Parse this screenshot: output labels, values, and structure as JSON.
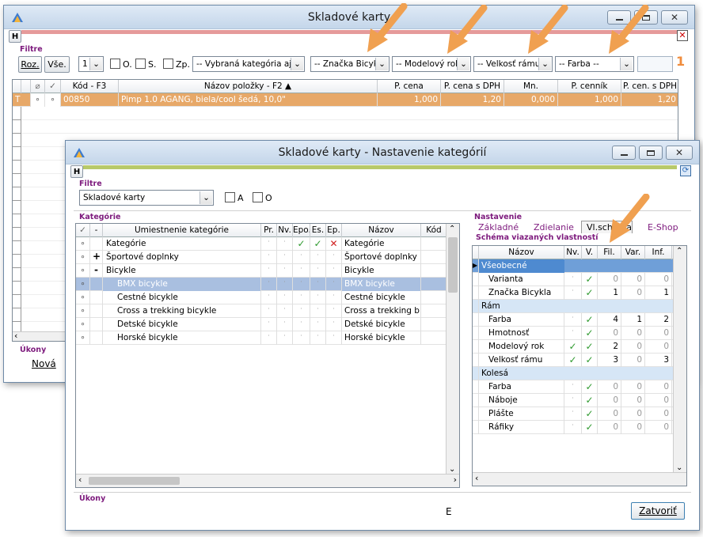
{
  "back": {
    "title": "Skladové karty",
    "h_button": "H",
    "filter_label": "Filtre",
    "btn_roz": "Roz.",
    "btn_vse": "Vše.",
    "level_value": "1",
    "chk_o": "O.",
    "chk_s": "S.",
    "chk_zp": "Zp.",
    "combo_category": "-- Vybraná kategória aj p",
    "combo_znacka": "-- Značka Bicykla",
    "combo_model": "-- Modelový rok --",
    "combo_velkost": "-- Velkosť rámu --",
    "combo_farba": "-- Farba --",
    "count_badge": "1",
    "columns": [
      "Kód - F3",
      "Názov položky - F2 ▲",
      "P. cena",
      "P. cena s DPH",
      "Mn.",
      "P. cenník",
      "P. cen. s DPH"
    ],
    "rows": [
      {
        "mark": "T",
        "code": "00850",
        "name": "Pimp 1.0 AGANG, biela/cool šedá, 10,0\"",
        "price": "1,000",
        "price_vat": "1,20",
        "qty": "0,000",
        "list": "1,000",
        "list_vat": "1,20"
      }
    ],
    "ukony_label": "Úkony",
    "nova_button": "Nová"
  },
  "front": {
    "title": "Skladové karty - Nastavenie kategórií",
    "h_button": "H",
    "filter_label": "Filtre",
    "filter_combo": "Skladové karty",
    "chk_a": "A",
    "chk_o": "O",
    "kategorie_label": "Kategórie",
    "cat_columns": [
      "✓",
      "-",
      "Umiestnenie kategórie",
      "Pr.",
      "Nv.",
      "Epo.",
      "Es.",
      "Ep.",
      "Názov",
      "Kód"
    ],
    "cat_rows": [
      {
        "dot": "∘",
        "tree": "",
        "place": "Kategórie",
        "name": "Kategórie",
        "epo": "check",
        "es": "check",
        "ep": "x"
      },
      {
        "dot": "∘",
        "tree": "+",
        "place": "Športové doplnky",
        "name": "Športové doplnky"
      },
      {
        "dot": "∘",
        "tree": "-",
        "place": "Bicykle",
        "name": "Bicykle"
      },
      {
        "dot": "∘",
        "tree": "",
        "place": "BMX bicykle",
        "name": "BMX bicykle",
        "selected": true
      },
      {
        "dot": "∘",
        "tree": "",
        "place": "Cestné bicykle",
        "name": "Cestné bicykle"
      },
      {
        "dot": "∘",
        "tree": "",
        "place": "Cross a trekking bicykle",
        "name": "Cross a trekking bicy"
      },
      {
        "dot": "∘",
        "tree": "",
        "place": "Detské bicykle",
        "name": "Detské bicykle"
      },
      {
        "dot": "∘",
        "tree": "",
        "place": "Horské bicykle",
        "name": "Horské bicykle"
      }
    ],
    "nastavenie_label": "Nastavenie",
    "tabs": [
      "Základné",
      "Zdielanie",
      "Vl.schéma",
      "E-Shop"
    ],
    "schema_label": "Schéma viazaných vlastností",
    "schema_columns": [
      "Názov",
      "Nv.",
      "V.",
      "Fil.",
      "Var.",
      "Inf."
    ],
    "schema_rows": [
      {
        "group": "Všeobecné",
        "current": true
      },
      {
        "name": "Varianta",
        "nv": "·",
        "v": "check",
        "fil": "0",
        "var": "0",
        "inf": "0"
      },
      {
        "name": "Značka Bicykla",
        "nv": "·",
        "v": "check",
        "fil": "1",
        "var": "0",
        "inf": "1"
      },
      {
        "group": "Rám"
      },
      {
        "name": "Farba",
        "nv": "·",
        "v": "check",
        "fil": "4",
        "var": "1",
        "inf": "2"
      },
      {
        "name": "Hmotnosť",
        "nv": "·",
        "v": "check",
        "fil": "0",
        "var": "0",
        "inf": "0"
      },
      {
        "name": "Modelový rok",
        "nv": "check",
        "v": "check",
        "fil": "2",
        "var": "0",
        "inf": "0"
      },
      {
        "name": "Velkosť rámu",
        "nv": "check",
        "v": "check",
        "fil": "3",
        "var": "0",
        "inf": "3"
      },
      {
        "group": "Kolesá"
      },
      {
        "name": "Farba",
        "nv": "·",
        "v": "check",
        "fil": "0",
        "var": "0",
        "inf": "0"
      },
      {
        "name": "Náboje",
        "nv": "·",
        "v": "check",
        "fil": "0",
        "var": "0",
        "inf": "0"
      },
      {
        "name": "Plášte",
        "nv": "·",
        "v": "check",
        "fil": "0",
        "var": "0",
        "inf": "0"
      },
      {
        "name": "Ráfiky",
        "nv": "·",
        "v": "check",
        "fil": "0",
        "var": "0",
        "inf": "0"
      }
    ],
    "ukony_label": "Úkony",
    "status_e": "E",
    "close_button": "Zatvoriť"
  },
  "colors": {
    "accent_orange": "#f0a050",
    "selected_row": "#a9bfe0",
    "highlight_row": "#e7a868",
    "group_row": "#d6e6f6"
  }
}
